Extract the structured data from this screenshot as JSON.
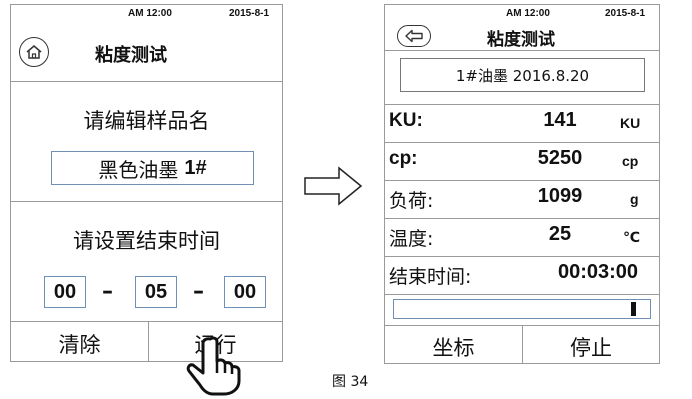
{
  "left_screen": {
    "status": {
      "time": "AM 12:00",
      "date": "2015-8-1"
    },
    "title": "粘度测试",
    "icons": {
      "home": "home-icon"
    },
    "sample_prompt": "请编辑样品名",
    "sample_name": "黑色油墨",
    "sample_suffix": "1#",
    "end_time_prompt": "请设置结束时间",
    "time_fields": [
      "00",
      "05",
      "00"
    ],
    "time_separator": "–",
    "clear_label": "清除",
    "run_label": "运行"
  },
  "right_screen": {
    "status": {
      "time": "AM 12:00",
      "date": "2015-8-1"
    },
    "title": "粘度测试",
    "icons": {
      "back": "back-arrow-icon"
    },
    "sample_name": "1#油墨 2016.8.20",
    "rows": [
      {
        "label": "KU:",
        "value": "141",
        "unit": "KU"
      },
      {
        "label": "cp:",
        "value": "5250",
        "unit": "cp"
      },
      {
        "label": "负荷:",
        "value": "1099",
        "unit": "g"
      },
      {
        "label": "温度:",
        "value": "25",
        "unit": "℃"
      }
    ],
    "end_time_label": "结束时间:",
    "end_time_value": "00:03:00",
    "progress_fraction": 0.95,
    "coord_label": "坐标",
    "stop_label": "停止"
  },
  "figure_caption": "图 34",
  "colors": {
    "border": "#9a9a9a",
    "field_border": "#6f8fb5"
  }
}
